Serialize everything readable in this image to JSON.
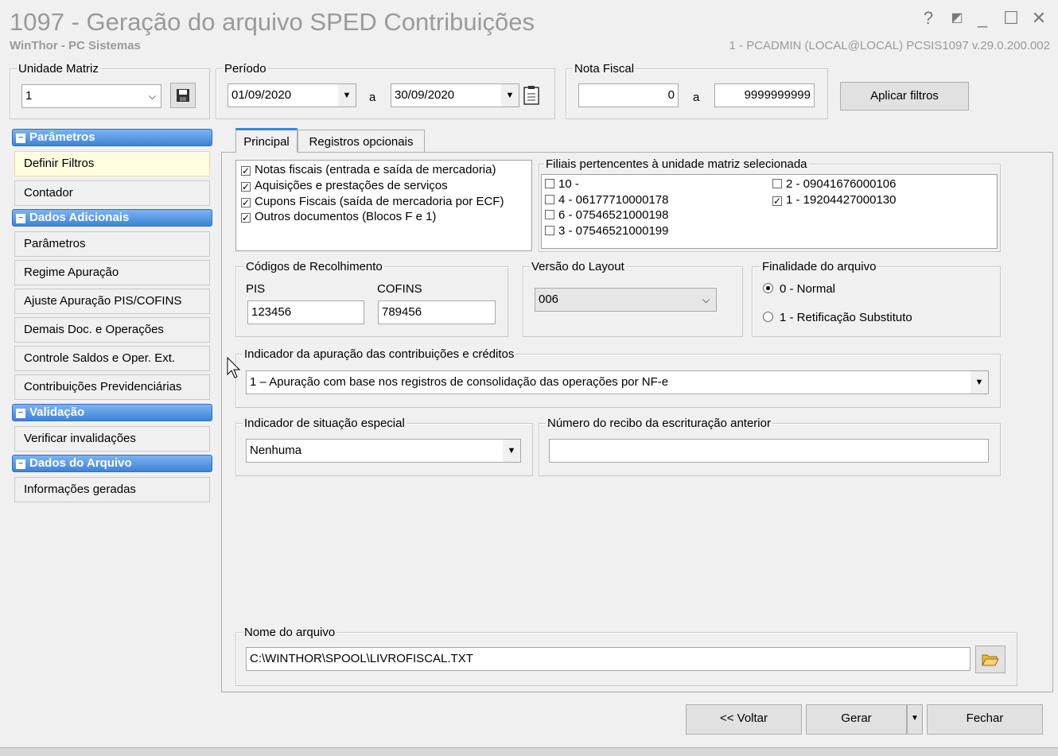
{
  "window": {
    "title": "1097 - Geração do arquivo SPED Contribuições",
    "subtitle": "WinThor - PC Sistemas",
    "user_info": "1 - PCADMIN (LOCAL@LOCAL)   PCSIS1097  v.29.0.200.002",
    "controls": {
      "help": "?",
      "minimize": "_",
      "maximize": "☐",
      "close": "✕"
    }
  },
  "filters": {
    "unidade_matriz": {
      "label": "Unidade Matriz",
      "value": "1"
    },
    "periodo": {
      "label": "Período",
      "from": "01/09/2020",
      "to_label": "a",
      "to": "30/09/2020"
    },
    "nota_fiscal": {
      "label": "Nota Fiscal",
      "from": "0",
      "to_label": "a",
      "to": "9999999999"
    },
    "apply_button": "Aplicar filtros"
  },
  "sidebar": {
    "groups": [
      {
        "title": "Parâmetros",
        "items": [
          "Definir Filtros",
          "Contador"
        ]
      },
      {
        "title": "Dados Adicionais",
        "items": [
          "Parâmetros",
          "Regime Apuração",
          "Ajuste Apuração PIS/COFINS",
          "Demais Doc. e Operações",
          "Controle Saldos e Oper. Ext.",
          "Contribuições Previdenciárias"
        ]
      },
      {
        "title": "Validação",
        "items": [
          "Verificar invalidações"
        ]
      },
      {
        "title": "Dados do Arquivo",
        "items": [
          "Informações geradas"
        ]
      }
    ]
  },
  "tabs": [
    "Principal",
    "Registros opcionais"
  ],
  "documents": [
    {
      "label": "Notas fiscais (entrada e saída de mercadoria)",
      "checked": true
    },
    {
      "label": "Aquisições e prestações de serviços",
      "checked": true
    },
    {
      "label": "Cupons Fiscais (saída de mercadoria por ECF)",
      "checked": true
    },
    {
      "label": "Outros documentos (Blocos F e 1)",
      "checked": true
    }
  ],
  "filiais": {
    "label": "Filiais pertencentes à unidade matriz selecionada",
    "left": [
      {
        "label": "10 -",
        "checked": false
      },
      {
        "label": "4 - 06177710000178",
        "checked": false
      },
      {
        "label": "6 - 07546521000198",
        "checked": false
      },
      {
        "label": "3 - 07546521000199",
        "checked": false
      }
    ],
    "right": [
      {
        "label": "2 - 09041676000106",
        "checked": false
      },
      {
        "label": "1 - 19204427000130",
        "checked": true
      }
    ]
  },
  "recolhimento": {
    "label": "Códigos de Recolhimento",
    "pis_label": "PIS",
    "pis": "123456",
    "cofins_label": "COFINS",
    "cofins": "789456"
  },
  "layout": {
    "label": "Versão do Layout",
    "value": "006"
  },
  "finalidade": {
    "label": "Finalidade do arquivo",
    "options": [
      "0 - Normal",
      "1 - Retificação Substituto"
    ],
    "selected": 0
  },
  "indicador_apuracao": {
    "label": "Indicador da apuração das contribuições e créditos",
    "value": "1 – Apuração com base nos registros de consolidação das operações por NF-e"
  },
  "situacao_especial": {
    "label": "Indicador de situação especial",
    "value": "Nenhuma"
  },
  "recibo": {
    "label": "Número do recibo da escrituração anterior",
    "value": ""
  },
  "arquivo": {
    "label": "Nome do arquivo",
    "value": "C:\\WINTHOR\\SPOOL\\LIVROFISCAL.TXT"
  },
  "footer": {
    "voltar": "<< Voltar",
    "gerar": "Gerar",
    "fechar": "Fechar"
  }
}
